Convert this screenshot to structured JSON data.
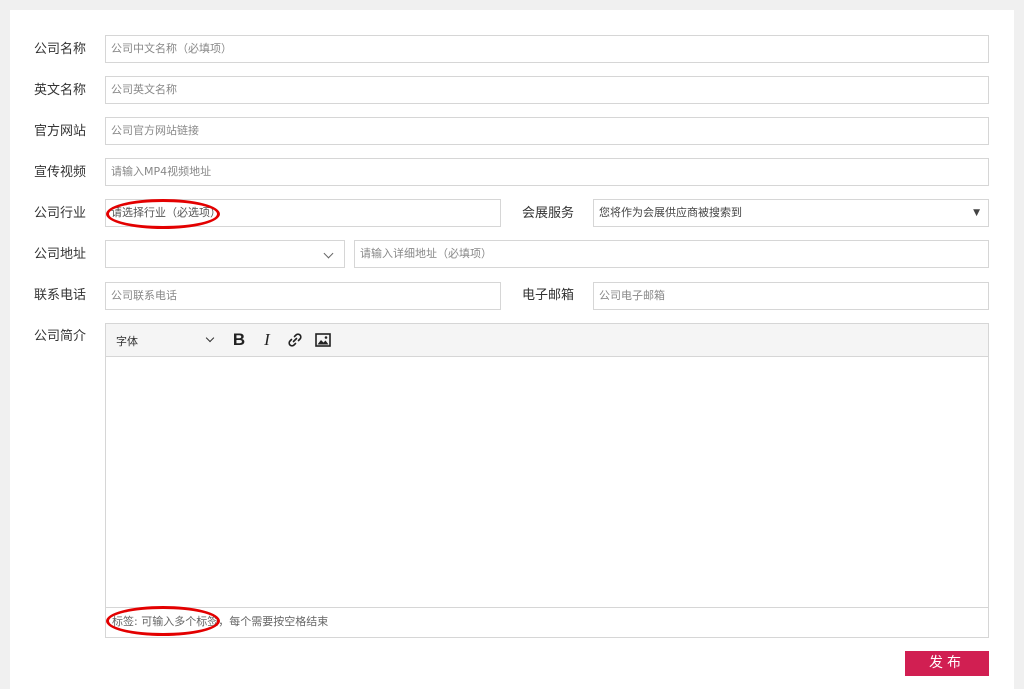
{
  "form": {
    "company_name": {
      "label": "公司名称",
      "placeholder": "公司中文名称（必填项）"
    },
    "english_name": {
      "label": "英文名称",
      "placeholder": "公司英文名称"
    },
    "website": {
      "label": "官方网站",
      "placeholder": "公司官方网站链接"
    },
    "video": {
      "label": "宣传视频",
      "placeholder": "请输入MP4视频地址"
    },
    "industry": {
      "label": "公司行业",
      "placeholder": "请选择行业（必选项）"
    },
    "expo_service": {
      "label": "会展服务",
      "value": "您将作为会展供应商被搜索到"
    },
    "address": {
      "label": "公司地址",
      "region_value": "",
      "detail_placeholder": "请输入详细地址（必填项）"
    },
    "phone": {
      "label": "联系电话",
      "placeholder": "公司联系电话"
    },
    "email": {
      "label": "电子邮箱",
      "placeholder": "公司电子邮箱"
    },
    "intro": {
      "label": "公司简介"
    }
  },
  "editor": {
    "font_select": "字体",
    "tags_placeholder": "标签: 可输入多个标签，每个需要按空格结束"
  },
  "publish_label": "发布",
  "icons": [
    "bold-icon",
    "italic-icon",
    "link-icon",
    "image-icon",
    "dropdown-caret-icon",
    "chevron-down-icon"
  ],
  "colors": {
    "accent": "#d11f52",
    "annotation": "#e30000",
    "border": "#d6d6d6",
    "background": "#f0f0f0"
  }
}
